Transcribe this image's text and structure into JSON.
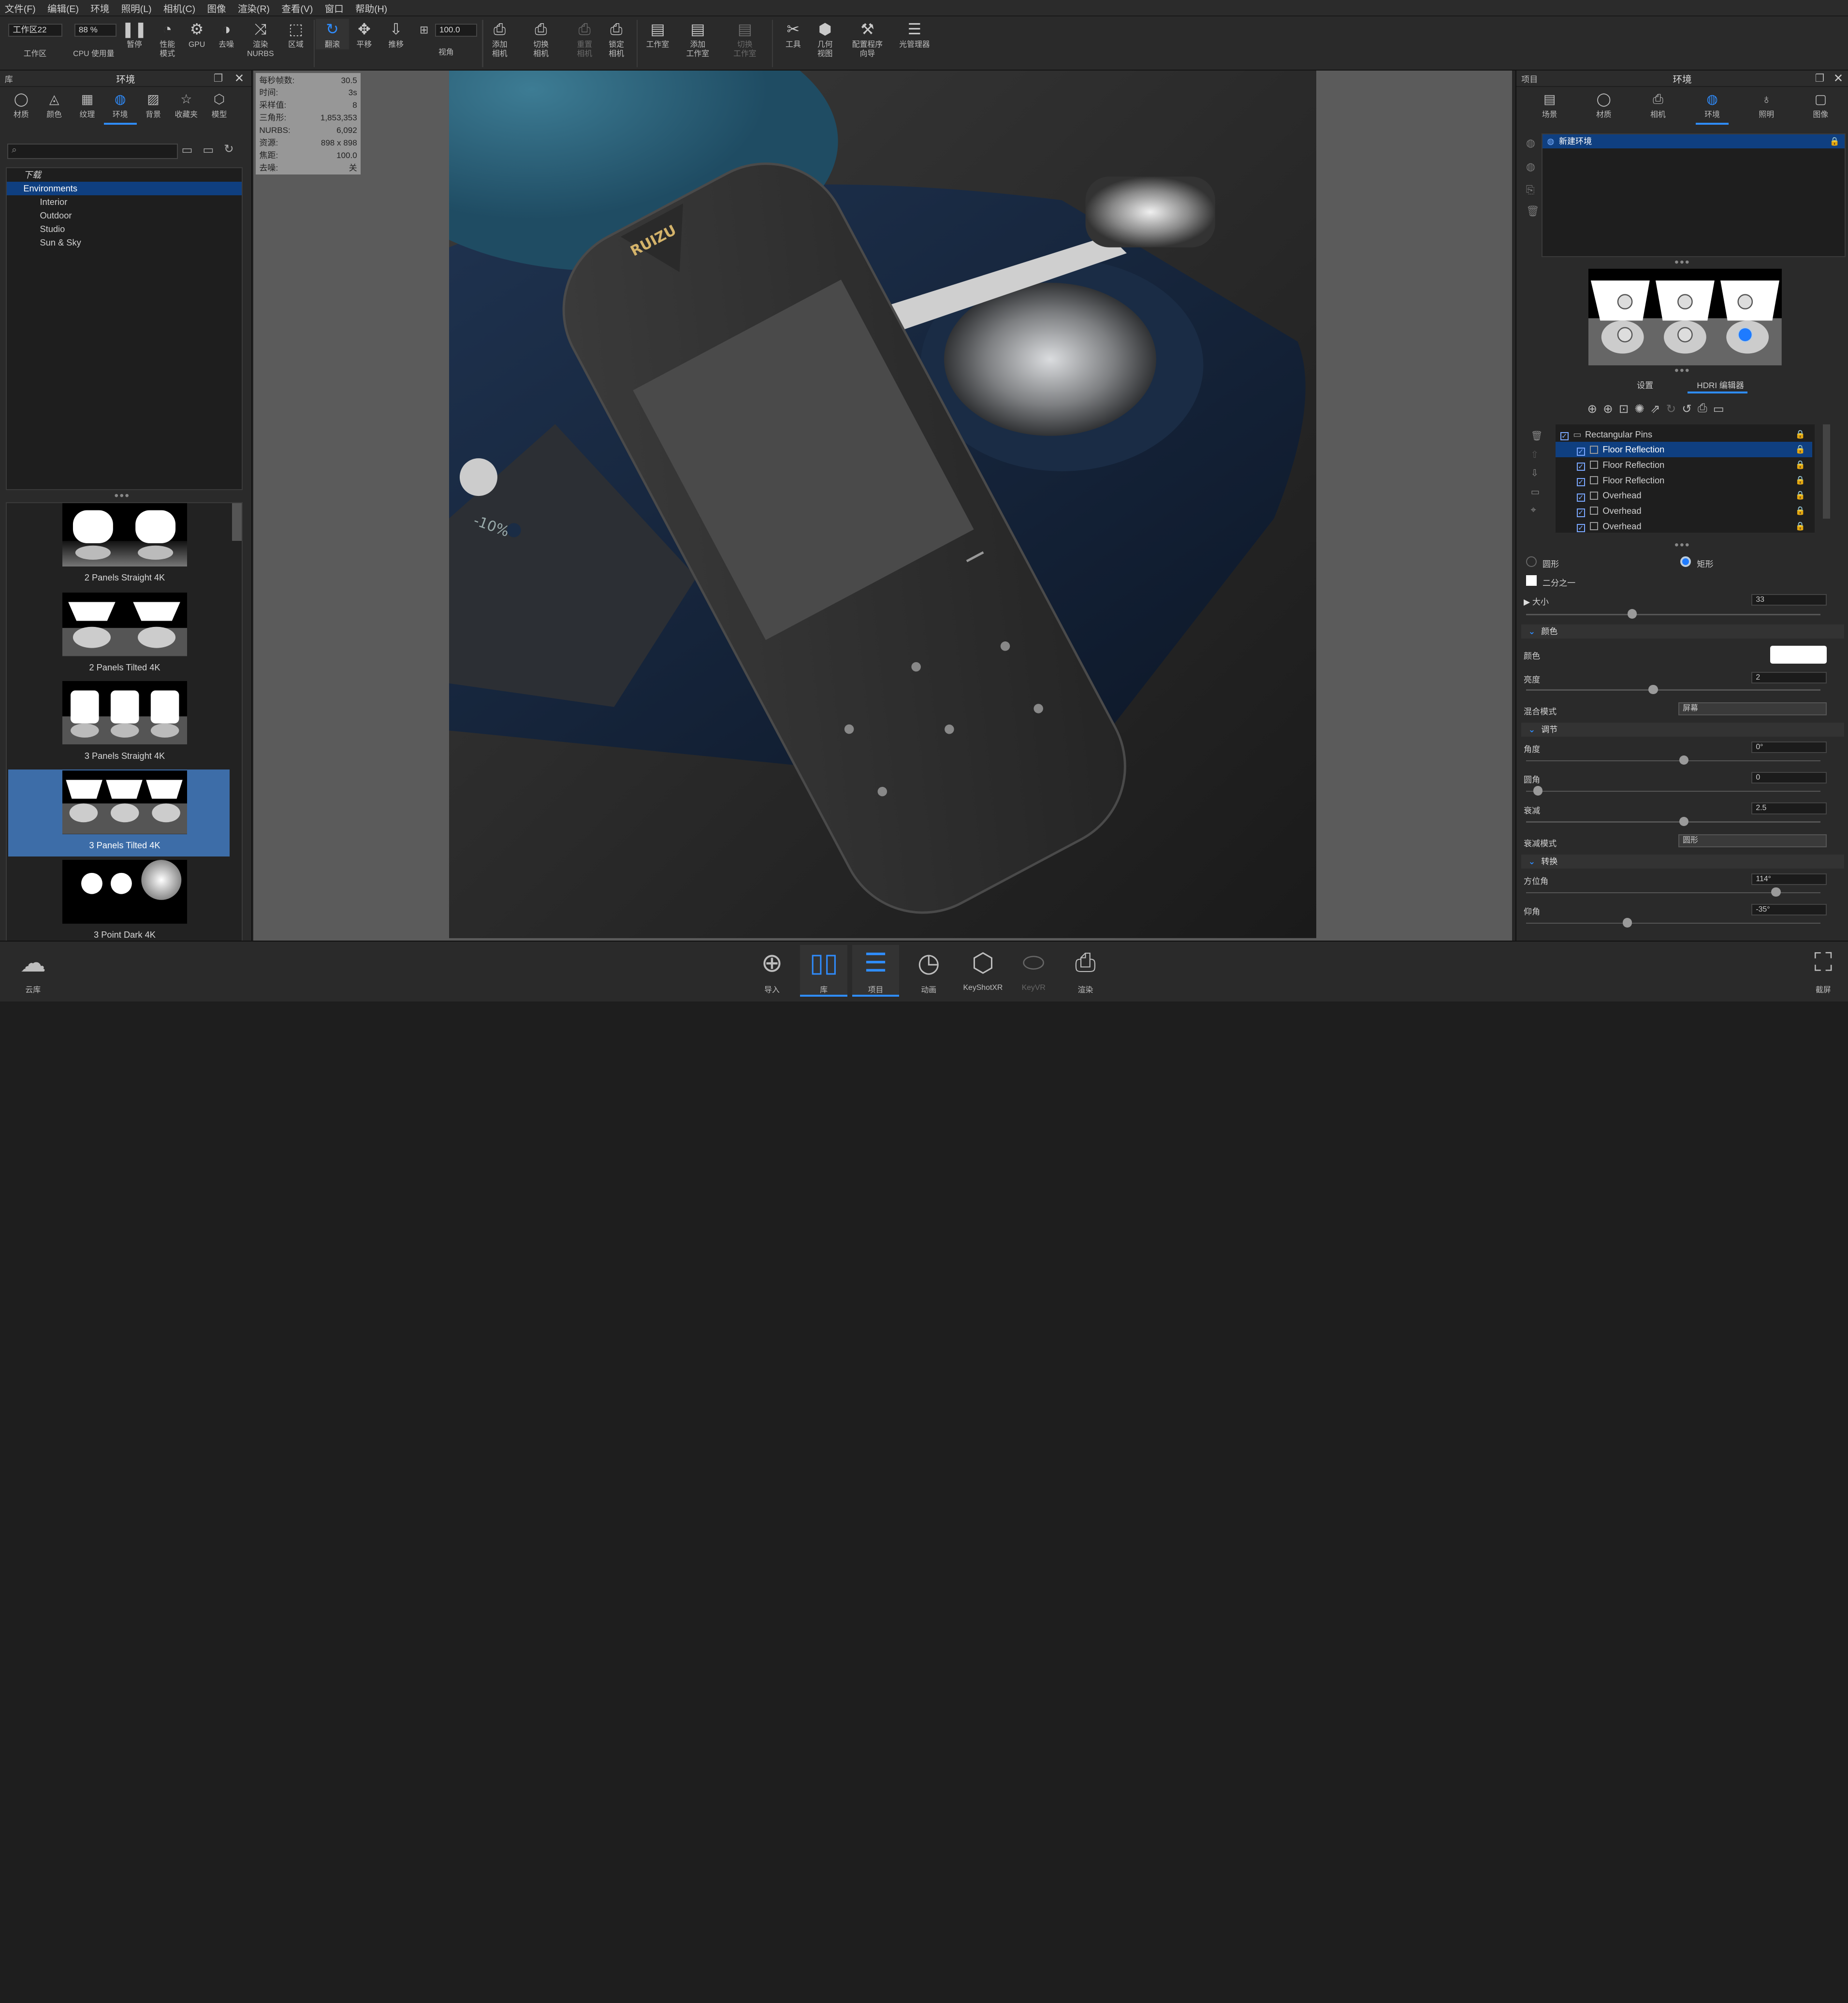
{
  "menubar": [
    "文件(F)",
    "编辑(E)",
    "环境",
    "照明(L)",
    "相机(C)",
    "图像",
    "渲染(R)",
    "查看(V)",
    "窗口",
    "帮助(H)"
  ],
  "toolbar": {
    "workspace_value": "工作区22",
    "workspace_label": "工作区",
    "cpu_value": "88 %",
    "cpu_label": "CPU 使用量",
    "pause": "暂停",
    "perf": "性能\n模式",
    "gpu": "GPU",
    "denoise": "去噪",
    "nurbs": "渲染\nNURBS",
    "region": "区域",
    "tumble": "翻滚",
    "pan": "平移",
    "dolly": "推移",
    "fov_value": "100.0",
    "fov_label": "视角",
    "add_camera": "添加\n相机",
    "switch_camera": "切换\n相机",
    "reset_camera": "重置\n相机",
    "lock_camera": "锁定\n相机",
    "studio": "工作室",
    "add_studio": "添加\n工作室",
    "switch_studio": "切换\n工作室",
    "tools": "工具",
    "geo_view": "几何\n视图",
    "config_wizard": "配置程序\n向导",
    "light_manager": "光管理器"
  },
  "library": {
    "title_left": "库",
    "title": "环境",
    "tabs": [
      "材质",
      "颜色",
      "纹理",
      "环境",
      "背景",
      "收藏夹",
      "模型"
    ],
    "tree": [
      "下载",
      "Environments",
      "Interior",
      "Outdoor",
      "Studio",
      "Sun & Sky"
    ],
    "thumbs": [
      "2 Panels Straight 4K",
      "2 Panels Tilted 4K",
      "3 Panels Straight 4K",
      "3 Panels Tilted 4K",
      "3 Point Dark 4K"
    ]
  },
  "stats": [
    {
      "k": "每秒帧数:",
      "v": "30.5"
    },
    {
      "k": "时间:",
      "v": "3s"
    },
    {
      "k": "采样值:",
      "v": "8"
    },
    {
      "k": "三角形:",
      "v": "1,853,353"
    },
    {
      "k": "NURBS:",
      "v": "6,092"
    },
    {
      "k": "资源:",
      "v": "898 x 898"
    },
    {
      "k": "焦距:",
      "v": "100.0"
    },
    {
      "k": "去噪:",
      "v": "关"
    }
  ],
  "render": {
    "brand": "RUIZU",
    "label": "-10%"
  },
  "project": {
    "title_left": "项目",
    "title": "环境",
    "tabs": [
      "场景",
      "材质",
      "相机",
      "环境",
      "照明",
      "图像"
    ],
    "env_item": "新建环境",
    "subtabs": [
      "设置",
      "HDRI 编辑器"
    ],
    "pins": [
      {
        "name": "Rectangular Pins",
        "group": true
      },
      {
        "name": "Floor Reflection",
        "sel": true
      },
      {
        "name": "Floor Reflection"
      },
      {
        "name": "Floor Reflection"
      },
      {
        "name": "Overhead"
      },
      {
        "name": "Overhead"
      },
      {
        "name": "Overhead"
      }
    ],
    "shape_circle": "圆形",
    "shape_rect": "矩形",
    "half": "二分之一",
    "size_label": "大小",
    "size_value": "33",
    "sec_color": "颜色",
    "color_label": "颜色",
    "brightness_label": "亮度",
    "brightness_value": "2",
    "blend_label": "混合模式",
    "blend_value": "屏幕",
    "sec_adjust": "调节",
    "angle_label": "角度",
    "angle_value": "0°",
    "round_label": "圆角",
    "round_value": "0",
    "falloff_label": "衰减",
    "falloff_value": "2.5",
    "falloff_mode_label": "衰减模式",
    "falloff_mode_value": "圆形",
    "sec_transform": "转换",
    "azimuth_label": "方位角",
    "azimuth_value": "114°",
    "elevation_label": "仰角",
    "elevation_value": "-35°"
  },
  "bottombar": {
    "cloud": "云库",
    "import": "导入",
    "library": "库",
    "project": "项目",
    "animation": "动画",
    "keyshotxr": "KeyShotXR",
    "keyvr": "KeyVR",
    "render": "渲染",
    "screenshot": "截屏"
  },
  "colors": {
    "accent": "#2f8dff",
    "selection": "#0f3f80",
    "panel": "#2a2a2a"
  }
}
